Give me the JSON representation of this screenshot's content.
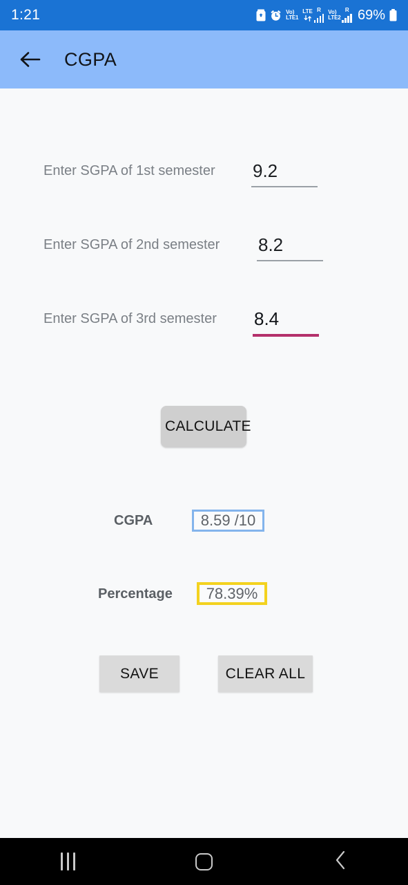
{
  "status_bar": {
    "clock": "1:21",
    "battery_percent": "69%",
    "icons": [
      "battery-saver-icon",
      "alarm-icon",
      "volte-sim1-icon",
      "lte-data-icon",
      "signal-sim1-icon",
      "volte-sim2-icon",
      "signal-sim2-icon",
      "battery-icon"
    ],
    "sim1_label_top": "Vo)",
    "sim1_label_bottom": "LTE1",
    "lte_label_top": "LTE",
    "lte_label_bottom": "R",
    "sim2_label_top": "Vo)",
    "sim2_label_bottom": "LTE2",
    "sim2_roam": "R",
    "bg_color": "#1a73d4"
  },
  "app_bar": {
    "title": "CGPA",
    "back_icon": "arrow-left-icon",
    "bg_color": "#8cbafa"
  },
  "form": {
    "fields": [
      {
        "label": "Enter SGPA of 1st semester",
        "value": "9.2",
        "focused": false,
        "underline_color": "#9aa0a6"
      },
      {
        "label": "Enter SGPA of 2nd semester",
        "value": "8.2",
        "focused": false,
        "underline_color": "#9aa0a6"
      },
      {
        "label": "Enter SGPA of 3rd semester",
        "value": "8.4",
        "focused": true,
        "underline_color": "#b4306b"
      }
    ],
    "calculate_label": "CALCULATE"
  },
  "results": {
    "cgpa_label": "CGPA",
    "cgpa_value": "8.59 /10",
    "cgpa_border_color": "#83b4ec",
    "percentage_label": "Percentage",
    "percentage_value": "78.39%",
    "percentage_border_color": "#f3d21f"
  },
  "actions": {
    "save_label": "SAVE",
    "clear_label": "CLEAR ALL"
  },
  "nav_bar": {
    "recents": "recents-icon",
    "home": "home-icon",
    "back": "back-chevron-icon",
    "bg_color": "#000000"
  }
}
